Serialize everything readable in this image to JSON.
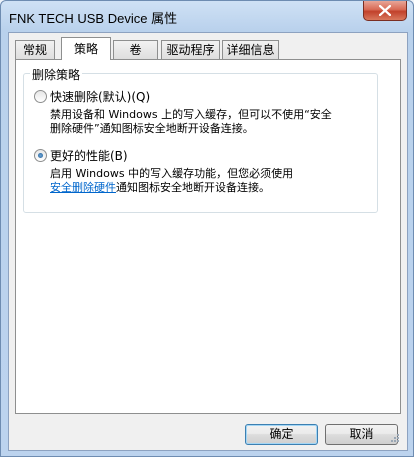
{
  "window": {
    "title": "FNK TECH USB Device 属性"
  },
  "tabs": [
    {
      "label": "常规",
      "active": false
    },
    {
      "label": "策略",
      "active": true
    },
    {
      "label": "卷",
      "active": false
    },
    {
      "label": "驱动程序",
      "active": false
    },
    {
      "label": "详细信息",
      "active": false
    }
  ],
  "policy": {
    "group_label": "删除策略",
    "options": [
      {
        "label": "快速删除(默认)(Q)",
        "checked": false,
        "desc_line1": "禁用设备和 Windows 上的写入缓存，但可以不使用“安全",
        "desc_line2": "删除硬件”通知图标安全地断开设备连接。"
      },
      {
        "label": "更好的性能(B)",
        "checked": true,
        "desc_line1": "启用 Windows 中的写入缓存功能，但您必须使用",
        "desc_link": "安全删除硬件",
        "desc_line2_rest": "通知图标安全地断开设备连接。"
      }
    ]
  },
  "buttons": {
    "ok": "确定",
    "cancel": "取消"
  },
  "colors": {
    "link": "#0066cc",
    "title_bar": "#b9d1ec",
    "close_button": "#c1412b"
  }
}
